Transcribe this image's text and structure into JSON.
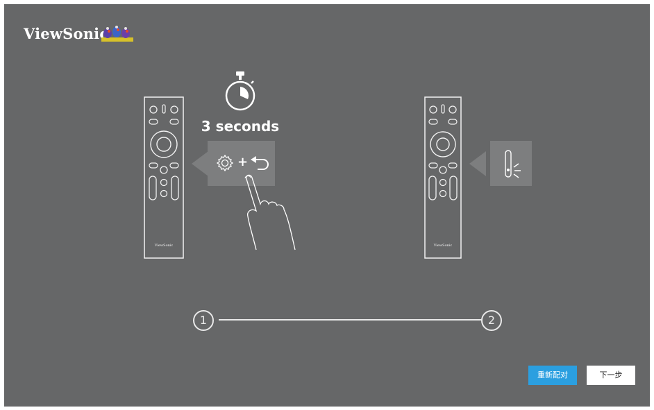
{
  "header": {
    "brand": "ViewSonic"
  },
  "step1": {
    "timer_label": "3 seconds",
    "remote_brand": "ViewSonic"
  },
  "step2": {
    "remote_brand": "ViewSonic"
  },
  "progress": {
    "steps": [
      "1",
      "2"
    ]
  },
  "buttons": {
    "repair": "重新配对",
    "next": "下一步"
  },
  "colors": {
    "background": "#666768",
    "accent": "#2b9fe0",
    "line": "#e9e9e9"
  },
  "icons": [
    "settings-gear-icon",
    "back-arrow-icon",
    "stopwatch-icon",
    "pointing-hand-icon",
    "led-blink-icon"
  ]
}
